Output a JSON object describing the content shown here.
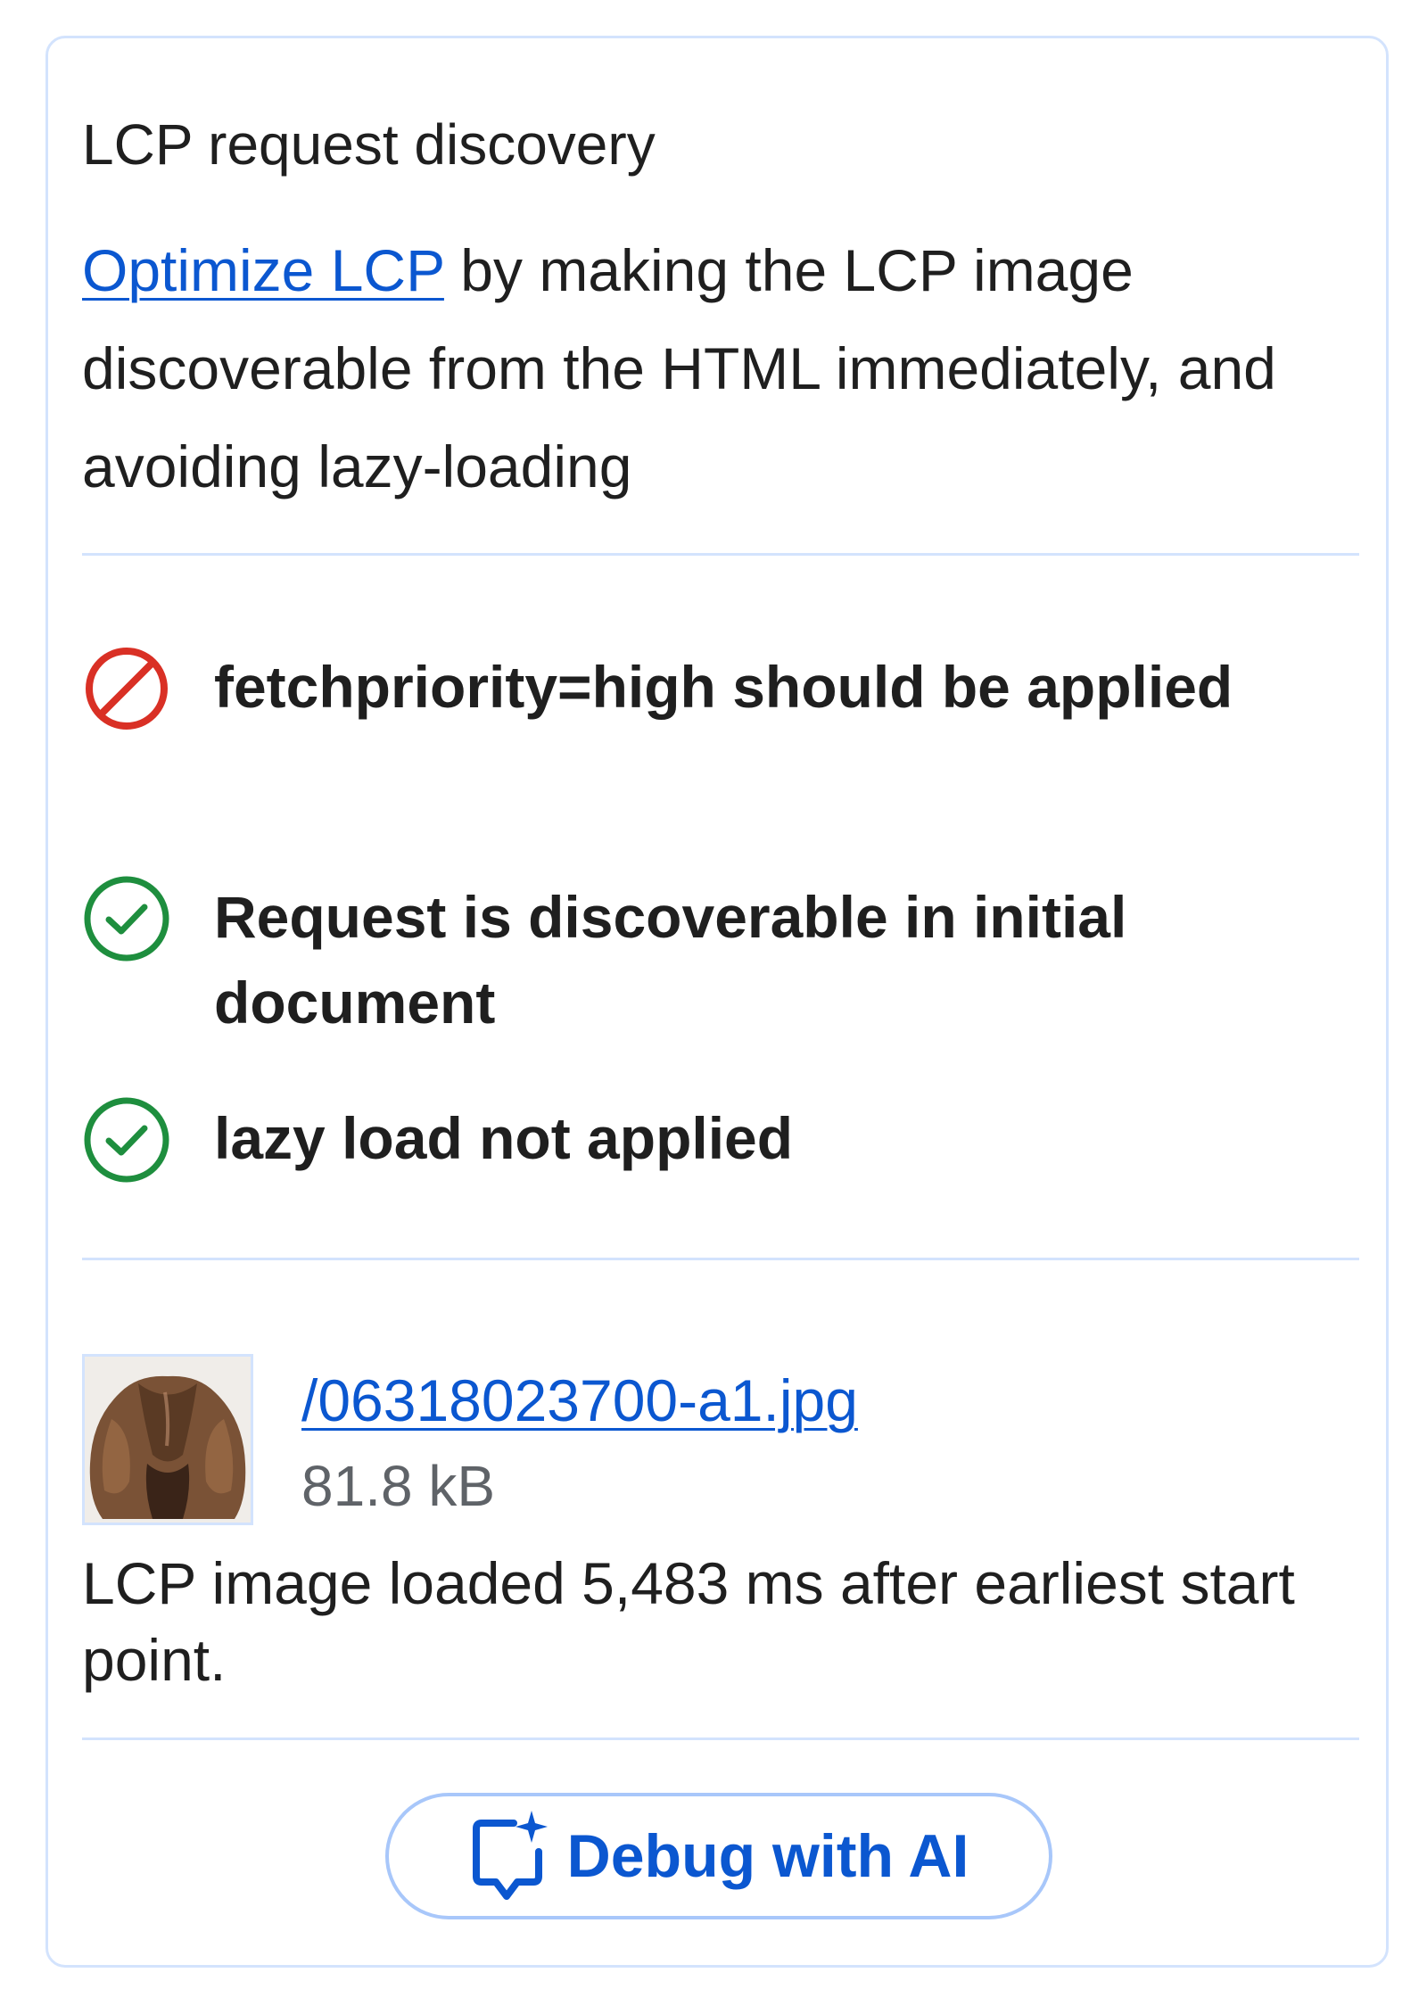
{
  "card": {
    "title": "LCP request discovery",
    "description": {
      "link_text": "Optimize LCP",
      "text": " by making the LCP image discoverable from the HTML immediately, and avoiding lazy-loading"
    },
    "checks": [
      {
        "status": "fail",
        "icon": "blocked-icon",
        "label": "fetchpriority=high should be applied"
      },
      {
        "status": "pass",
        "icon": "check-circle-icon",
        "label": "Request is discoverable in initial document"
      },
      {
        "status": "pass",
        "icon": "check-circle-icon",
        "label": "lazy load not applied"
      }
    ],
    "resource": {
      "file_name": "/06318023700-a1.jpg",
      "size": "81.8 kB",
      "thumbnail_icon": "fur-coat-thumbnail"
    },
    "summary": "LCP image loaded 5,483 ms after earliest start point.",
    "debug_button_label": "Debug with AI",
    "colors": {
      "link": "#0b57d0",
      "fail": "#d93025",
      "pass": "#1e8e3e",
      "divider": "#d3e3fd",
      "button_border": "#a8c7fa"
    }
  }
}
